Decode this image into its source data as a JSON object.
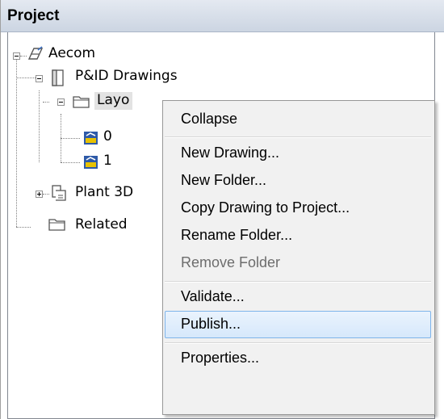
{
  "panel": {
    "title": "Project"
  },
  "tree": {
    "root": {
      "label": "Aecom",
      "icon": "project-icon",
      "expanded": true
    },
    "pid_drawings": {
      "label": "P&ID Drawings",
      "icon": "drawings-folder-icon",
      "expanded": true
    },
    "layout_folder": {
      "label": "Layo",
      "icon": "folder-icon",
      "expanded": true
    },
    "drawing_0": {
      "label": "0",
      "icon": "drawing-file-icon"
    },
    "drawing_1": {
      "label": "1",
      "icon": "drawing-file-icon"
    },
    "plant3d": {
      "label": "Plant 3D",
      "icon": "plant3d-icon",
      "expanded": false
    },
    "related": {
      "label": "Related",
      "icon": "folder-icon"
    }
  },
  "context_menu": {
    "items": [
      {
        "label": "Collapse",
        "enabled": true,
        "highlighted": false
      },
      {
        "label": "New Drawing...",
        "enabled": true,
        "highlighted": false
      },
      {
        "label": "New Folder...",
        "enabled": true,
        "highlighted": false
      },
      {
        "label": "Copy Drawing to Project...",
        "enabled": true,
        "highlighted": false
      },
      {
        "label": "Rename Folder...",
        "enabled": true,
        "highlighted": false
      },
      {
        "label": "Remove Folder",
        "enabled": false,
        "highlighted": false
      },
      {
        "label": "Validate...",
        "enabled": true,
        "highlighted": false
      },
      {
        "label": "Publish...",
        "enabled": true,
        "highlighted": true
      },
      {
        "label": "Properties...",
        "enabled": true,
        "highlighted": false
      }
    ]
  },
  "colors": {
    "menu_background": "#f1f1f1",
    "highlight_border": "#7eb4ea",
    "highlight_fill": "#d6e8fb",
    "header_background": "#d4dce8"
  }
}
